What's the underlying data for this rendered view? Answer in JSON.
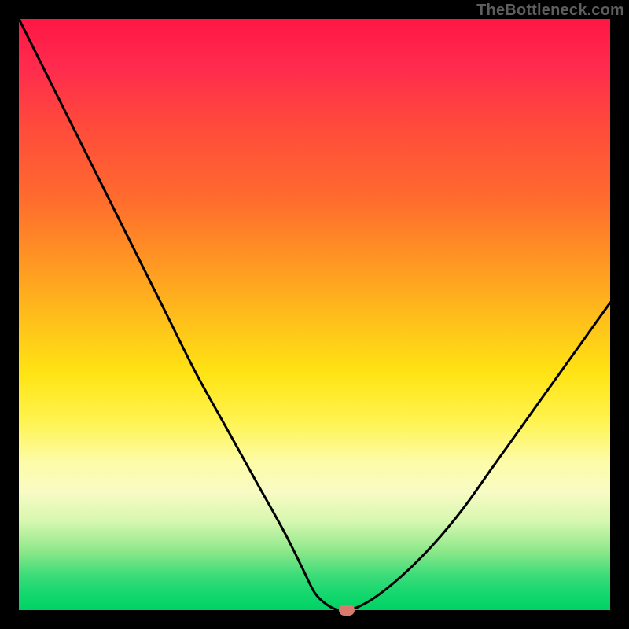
{
  "watermark": "TheBottleneck.com",
  "chart_data": {
    "type": "line",
    "title": "",
    "xlabel": "",
    "ylabel": "",
    "x": [
      0.0,
      0.05,
      0.1,
      0.15,
      0.2,
      0.25,
      0.3,
      0.35,
      0.4,
      0.45,
      0.48,
      0.5,
      0.52,
      0.54,
      0.56,
      0.6,
      0.65,
      0.7,
      0.75,
      0.8,
      0.85,
      0.9,
      0.95,
      1.0
    ],
    "values": [
      1.0,
      0.9,
      0.8,
      0.7,
      0.6,
      0.5,
      0.4,
      0.31,
      0.22,
      0.13,
      0.07,
      0.03,
      0.01,
      0.0,
      0.0,
      0.02,
      0.06,
      0.11,
      0.17,
      0.24,
      0.31,
      0.38,
      0.45,
      0.52
    ],
    "xlim": [
      0,
      1
    ],
    "ylim": [
      0,
      1
    ],
    "marker": {
      "x": 0.555,
      "y": 0.0
    },
    "background_gradient": {
      "top": "#ff1744",
      "mid_orange": "#ff9a22",
      "mid_yellow": "#fff350",
      "bottom": "#00d264"
    }
  }
}
